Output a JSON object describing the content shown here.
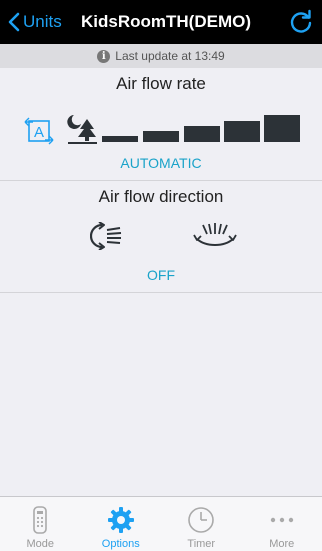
{
  "navbar": {
    "back_label": "Units",
    "title": "KidsRoomTH(DEMO)"
  },
  "update_bar": {
    "text": "Last update at 13:49"
  },
  "air_flow_rate": {
    "title": "Air flow rate",
    "status": "AUTOMATIC",
    "icons": [
      "auto-mode-icon",
      "quiet-night-icon"
    ],
    "levels": 5
  },
  "air_flow_direction": {
    "title": "Air flow direction",
    "status": "OFF",
    "icons": [
      "vertical-swing-icon",
      "horizontal-swing-icon"
    ]
  },
  "tabbar": {
    "tabs": [
      {
        "label": "Mode",
        "icon": "remote-icon"
      },
      {
        "label": "Options",
        "icon": "gear-icon"
      },
      {
        "label": "Timer",
        "icon": "clock-icon"
      },
      {
        "label": "More",
        "icon": "more-dots-icon"
      }
    ],
    "active_tab": "Options"
  },
  "colors": {
    "accent": "#1ea1f2",
    "status_text": "#1aa3c9",
    "navbar_bg": "#000000",
    "page_bg": "#efeff4",
    "bar_fill": "#2c3237"
  }
}
